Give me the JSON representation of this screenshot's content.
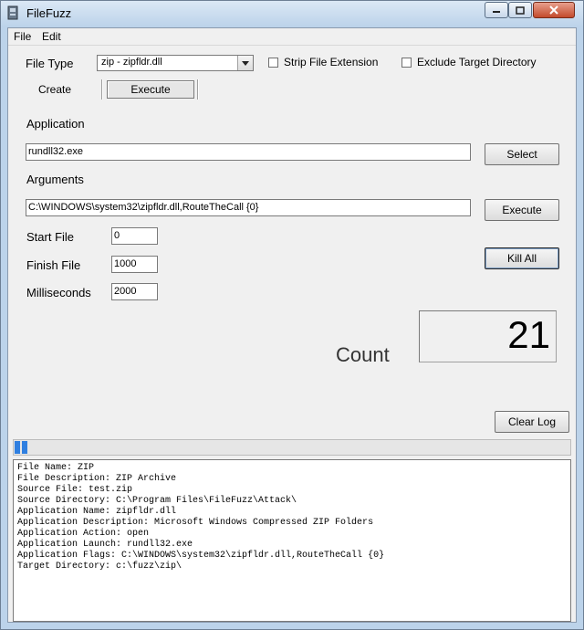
{
  "window": {
    "title": "FileFuzz"
  },
  "menu": [
    "File",
    "Edit"
  ],
  "file_type": {
    "label": "File Type",
    "selected": "zip - zipfldr.dll"
  },
  "options": {
    "strip_ext": "Strip File Extension",
    "exclude_target": "Exclude Target Directory"
  },
  "tabs": {
    "create": "Create",
    "execute": "Execute"
  },
  "application": {
    "label": "Application",
    "value": "rundll32.exe",
    "select_button": "Select"
  },
  "arguments": {
    "label": "Arguments",
    "value": "C:\\WINDOWS\\system32\\zipfldr.dll,RouteTheCall {0}",
    "execute_button": "Execute"
  },
  "start_file": {
    "label": "Start File",
    "value": "0"
  },
  "finish_file": {
    "label": "Finish File",
    "value": "1000"
  },
  "milliseconds": {
    "label": "Milliseconds",
    "value": "2000"
  },
  "kill_all_button": "Kill All",
  "count": {
    "label": "Count",
    "value": "21"
  },
  "clear_log_button": "Clear Log",
  "progress": {
    "fraction": 0.021
  },
  "log_lines": [
    "File Name: ZIP",
    "File Description: ZIP Archive",
    "Source File: test.zip",
    "Source Directory: C:\\Program Files\\FileFuzz\\Attack\\",
    "Application Name: zipfldr.dll",
    "Application Description: Microsoft Windows Compressed ZIP Folders",
    "Application Action: open",
    "Application Launch: rundll32.exe",
    "Application Flags: C:\\WINDOWS\\system32\\zipfldr.dll,RouteTheCall {0}",
    "Target Directory: c:\\fuzz\\zip\\"
  ],
  "colors": {
    "titlebar": "#bcd3ea",
    "progress": "#2f7fe0",
    "panel": "#f0f0f0"
  },
  "icons": [
    "app-icon",
    "minimize-icon",
    "maximize-icon",
    "close-icon",
    "dropdown-arrow-icon"
  ]
}
